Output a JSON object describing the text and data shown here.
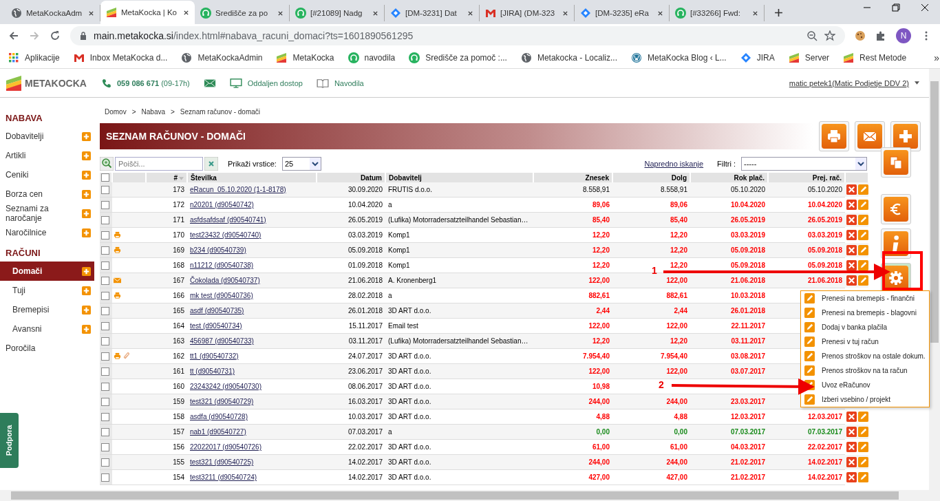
{
  "browser": {
    "tabs": [
      {
        "title": "MetaKockaAdm",
        "kind": "globe",
        "selected": false
      },
      {
        "title": "MetaKocka | Ko",
        "kind": "metakocka",
        "selected": true
      },
      {
        "title": "Središče za po",
        "kind": "headset",
        "selected": false
      },
      {
        "title": "[#21089] Nadg",
        "kind": "headset",
        "selected": false
      },
      {
        "title": "[DM-3231] Dat",
        "kind": "jira",
        "selected": false
      },
      {
        "title": "[JIRA] (DM-323",
        "kind": "gmail",
        "selected": false
      },
      {
        "title": "[DM-3235] eRa",
        "kind": "jira",
        "selected": false
      },
      {
        "title": "[#33266] Fwd:",
        "kind": "headset",
        "selected": false
      }
    ],
    "url_host": "main.metakocka.si",
    "url_path": "/index.html#nabava_racuni_domaci?ts=1601890561295",
    "profile_initial": "N",
    "bookmarks": [
      {
        "label": "Aplikacije",
        "kind": "apps"
      },
      {
        "label": "Inbox MetaKocka d...",
        "kind": "gmail"
      },
      {
        "label": "MetaKockaAdmin",
        "kind": "globe"
      },
      {
        "label": "MetaKocka",
        "kind": "metakocka"
      },
      {
        "label": "navodila",
        "kind": "headset"
      },
      {
        "label": "Središče za pomoč :...",
        "kind": "headset"
      },
      {
        "label": "Metakocka - Localiz...",
        "kind": "globe"
      },
      {
        "label": "MetaKocka Blog ‹ L...",
        "kind": "wordpress"
      },
      {
        "label": "JIRA",
        "kind": "jira"
      },
      {
        "label": "Server",
        "kind": "metakocka"
      },
      {
        "label": "Rest Metode",
        "kind": "metakocka"
      }
    ],
    "bookmarks_more": "»"
  },
  "header": {
    "logo": "METAKOCKA",
    "phone": "059 086 671",
    "hours": "(09-17h)",
    "remote": "Oddaljen dostop",
    "guide": "Navodila",
    "user": "matic petek1(Matic Podjetje DDV 2)"
  },
  "sidebar": [
    {
      "kind": "heading",
      "label": "NABAVA"
    },
    {
      "kind": "item",
      "label": "Dobavitelji",
      "add": true,
      "selected": false
    },
    {
      "kind": "item",
      "label": "Artikli",
      "add": true,
      "selected": false
    },
    {
      "kind": "item",
      "label": "Ceniki",
      "add": true,
      "selected": false
    },
    {
      "kind": "item",
      "label": "Borza cen",
      "add": true,
      "selected": false
    },
    {
      "kind": "item",
      "label": "Seznami za naročanje",
      "add": true,
      "selected": false
    },
    {
      "kind": "item",
      "label": "Naročilnice",
      "add": true,
      "selected": false
    },
    {
      "kind": "heading",
      "label": "RAČUNI"
    },
    {
      "kind": "subitem",
      "label": "Domači",
      "add": true,
      "selected": true
    },
    {
      "kind": "subitem",
      "label": "Tuji",
      "add": true,
      "selected": false
    },
    {
      "kind": "subitem",
      "label": "Bremepisi",
      "add": true,
      "selected": false
    },
    {
      "kind": "subitem",
      "label": "Avansni",
      "add": true,
      "selected": false
    },
    {
      "kind": "item",
      "label": "Poročila",
      "add": false,
      "selected": false
    }
  ],
  "support_tab": "Podpora",
  "breadcrumb": [
    "Domov",
    "Nabava",
    "Seznam računov - domači"
  ],
  "breadcrumb_separator": ">",
  "page_title": "SEZNAM RAČUNOV - DOMAČI",
  "search": {
    "placeholder": "Poišči..."
  },
  "rows_label": "Prikaži vrstice:",
  "rows_value": "25",
  "advanced_search": "Napredno iskanje",
  "filter_label": "Filtri :",
  "filter_value": "-----",
  "top_actions": [
    {
      "kind": "print"
    },
    {
      "kind": "mail"
    },
    {
      "kind": "add"
    }
  ],
  "side_actions": [
    {
      "kind": "copy"
    },
    {
      "kind": "euro"
    },
    {
      "kind": "info"
    },
    {
      "kind": "settings"
    }
  ],
  "table": {
    "select_all_checked": false,
    "columns": [
      "#",
      "Številka",
      "Datum",
      "Dobavitelj",
      "Znesek",
      "Dolg",
      "Rok plač.",
      "Prej. rač."
    ],
    "rows": [
      {
        "checked": false,
        "icons": [],
        "num": "173",
        "doc": "eRacun_05.10.2020 (1-1-8178)",
        "date": "30.09.2020",
        "supplier": "FRUTIS d.o.o.",
        "amount": "8.558,91",
        "debt": "8.558,91",
        "due": "05.10.2020",
        "prev": "05.10.2020",
        "kind": "open"
      },
      {
        "checked": false,
        "icons": [],
        "num": "172",
        "doc": "n20201 (d90540742)",
        "date": "10.04.2020",
        "supplier": "a",
        "amount": "89,06",
        "debt": "89,06",
        "due": "10.04.2020",
        "prev": "10.04.2020",
        "kind": "overdue"
      },
      {
        "checked": false,
        "icons": [],
        "num": "171",
        "doc": "asfdsafdsaf (d90540741)",
        "date": "26.05.2019",
        "supplier": "(Lufika) Motorradersatzteilhandel Sebastian…",
        "amount": "85,40",
        "debt": "85,40",
        "due": "26.05.2019",
        "prev": "26.05.2019",
        "kind": "overdue"
      },
      {
        "checked": false,
        "icons": [
          {
            "kind": "print"
          }
        ],
        "num": "170",
        "doc": "test23432 (d90540740)",
        "date": "03.03.2019",
        "supplier": "Komp1",
        "amount": "12,20",
        "debt": "12,20",
        "due": "03.03.2019",
        "prev": "03.03.2019",
        "kind": "overdue"
      },
      {
        "checked": false,
        "icons": [
          {
            "kind": "print"
          }
        ],
        "num": "169",
        "doc": "b234 (d90540739)",
        "date": "05.09.2018",
        "supplier": "Komp1",
        "amount": "12,20",
        "debt": "12,20",
        "due": "05.09.2018",
        "prev": "05.09.2018",
        "kind": "overdue"
      },
      {
        "checked": false,
        "icons": [],
        "num": "168",
        "doc": "n11212 (d90540738)",
        "date": "01.09.2018",
        "supplier": "Komp1",
        "amount": "12,20",
        "debt": "12,20",
        "due": "05.09.2018",
        "prev": "05.09.2018",
        "kind": "overdue"
      },
      {
        "checked": false,
        "icons": [
          {
            "kind": "mail"
          }
        ],
        "num": "167",
        "doc": "Čokolada (d90540737)",
        "date": "21.06.2018",
        "supplier": "A. Kronenberg1",
        "amount": "122,00",
        "debt": "122,00",
        "due": "21.06.2018",
        "prev": "21.06.2018",
        "kind": "overdue"
      },
      {
        "checked": false,
        "icons": [
          {
            "kind": "print"
          }
        ],
        "num": "166",
        "doc": "mk test (d90540736)",
        "date": "28.02.2018",
        "supplier": "a",
        "amount": "882,61",
        "debt": "882,61",
        "due": "10.03.2018",
        "kind": "overdue"
      },
      {
        "checked": false,
        "icons": [],
        "num": "165",
        "doc": "asdf (d90540735)",
        "date": "26.01.2018",
        "supplier": "3D ART d.o.o.",
        "amount": "2,44",
        "debt": "2,44",
        "due": "26.01.2018",
        "kind": "overdue"
      },
      {
        "checked": false,
        "icons": [],
        "num": "164",
        "doc": "test (d90540734)",
        "date": "15.11.2017",
        "supplier": "Email test",
        "amount": "122,00",
        "debt": "122,00",
        "due": "22.11.2017",
        "kind": "overdue"
      },
      {
        "checked": false,
        "icons": [],
        "num": "163",
        "doc": "456987 (d90540733)",
        "date": "03.11.2017",
        "supplier": "(Lufika) Motorradersatzteilhandel Sebastian…",
        "amount": "12,20",
        "debt": "12,20",
        "due": "03.11.2017",
        "kind": "overdue"
      },
      {
        "checked": false,
        "icons": [
          {
            "kind": "print"
          },
          {
            "kind": "attachment"
          }
        ],
        "num": "162",
        "doc": "tt1 (d90540732)",
        "date": "24.07.2017",
        "supplier": "3D ART d.o.o.",
        "amount": "7.954,40",
        "debt": "7.954,40",
        "due": "03.08.2017",
        "kind": "overdue"
      },
      {
        "checked": false,
        "icons": [],
        "num": "161",
        "doc": "tt (d90540731)",
        "date": "23.06.2017",
        "supplier": "3D ART d.o.o.",
        "amount": "122,00",
        "debt": "122,00",
        "due": "03.07.2017",
        "kind": "overdue"
      },
      {
        "checked": false,
        "icons": [],
        "num": "160",
        "doc": "23243242 (d90540730)",
        "date": "08.06.2017",
        "supplier": "3D ART d.o.o.",
        "amount": "10,98",
        "kind": "overdue"
      },
      {
        "checked": false,
        "icons": [],
        "num": "159",
        "doc": "test321 (d90540729)",
        "date": "16.03.2017",
        "supplier": "3D ART d.o.o.",
        "amount": "244,00",
        "debt": "244,00",
        "due": "23.03.2017",
        "kind": "overdue"
      },
      {
        "checked": false,
        "icons": [],
        "num": "158",
        "doc": "asdfa (d90540728)",
        "date": "10.03.2017",
        "supplier": "3D ART d.o.o.",
        "amount": "4,88",
        "debt": "4,88",
        "due": "12.03.2017",
        "prev": "12.03.2017",
        "kind": "overdue"
      },
      {
        "checked": false,
        "icons": [],
        "num": "157",
        "doc": "nab1 (d90540727)",
        "date": "07.03.2017",
        "supplier": "a",
        "amount": "0,00",
        "debt": "0,00",
        "due": "07.03.2017",
        "prev": "07.03.2017",
        "kind": "paid"
      },
      {
        "checked": false,
        "icons": [],
        "num": "156",
        "doc": "22022017 (d90540726)",
        "date": "22.02.2017",
        "supplier": "3D ART d.o.o.",
        "amount": "61,00",
        "debt": "61,00",
        "due": "04.03.2017",
        "prev": "22.02.2017",
        "kind": "overdue"
      },
      {
        "checked": false,
        "icons": [],
        "num": "155",
        "doc": "test321 (d90540725)",
        "date": "14.02.2017",
        "supplier": "3D ART d.o.o.",
        "amount": "244,00",
        "debt": "244,00",
        "due": "21.02.2017",
        "prev": "14.02.2017",
        "kind": "overdue"
      },
      {
        "checked": false,
        "icons": [],
        "num": "154",
        "doc": "test3211 (d90540724)",
        "date": "14.02.2017",
        "supplier": "3D ART d.o.o.",
        "amount": "427,00",
        "debt": "427,00",
        "due": "21.02.2017",
        "prev": "14.02.2017",
        "kind": "overdue"
      }
    ]
  },
  "actions_menu": {
    "items": [
      "Prenesi na bremepis - finančni",
      "Prenesi na bremepis - blagovni",
      "Dodaj v banka plačila",
      "Prenesi v tuj račun",
      "Prenos stroškov na ostale dokum.",
      "Prenos stroškov na ta račun",
      "Uvoz eRačunov",
      "Izberi vsebino / projekt"
    ]
  },
  "annotations": [
    {
      "label": "1"
    },
    {
      "label": "2"
    }
  ]
}
